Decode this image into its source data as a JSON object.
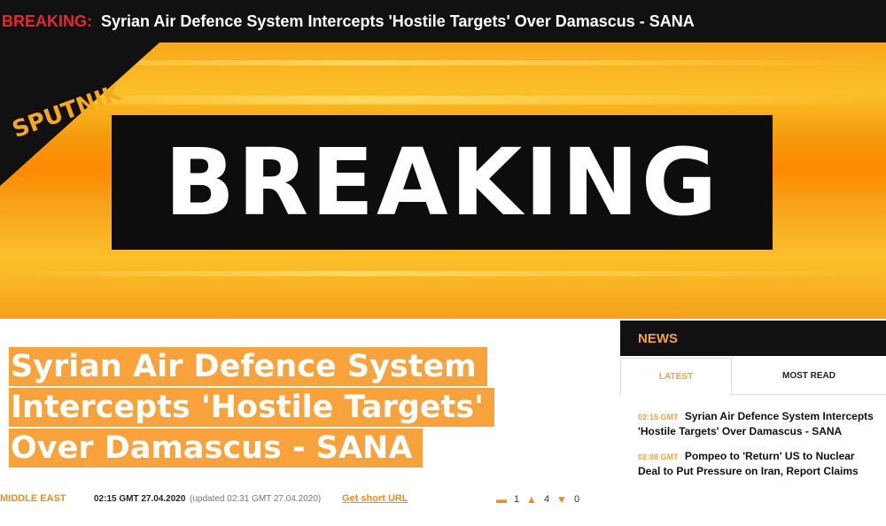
{
  "topbar": {
    "label": "BREAKING:",
    "title": "Syrian Air Defence System Intercepts 'Hostile Targets' Over Damascus - SANA"
  },
  "banner": {
    "logo": "SPUTNIK",
    "breaking_text": "BREAKING"
  },
  "article": {
    "headline_lines": [
      "Syrian Air Defence System",
      "Intercepts 'Hostile Targets'",
      "Over Damascus - SANA"
    ],
    "category": "MIDDLE EAST",
    "published": "02:15 GMT 27.04.2020",
    "updated": "(updated 02:31 GMT 27.04.2020)",
    "short_url_label": "Get short URL",
    "comments_count": "1",
    "likes_count": "4",
    "dislikes_count": "0"
  },
  "news": {
    "header": "NEWS",
    "tabs": [
      "LATEST",
      "MOST READ"
    ],
    "items": [
      {
        "time": "02:15 GMT",
        "title": "Syrian Air Defence System Intercepts 'Hostile Targets' Over Damascus - SANA"
      },
      {
        "time": "02:08 GMT",
        "title": "Pompeo to 'Return' US to Nuclear Deal to Put Pressure on Iran, Report Claims"
      }
    ]
  },
  "colors": {
    "accent": "#f7a23b",
    "breaking_red": "#e8262e",
    "dark": "#111111"
  }
}
